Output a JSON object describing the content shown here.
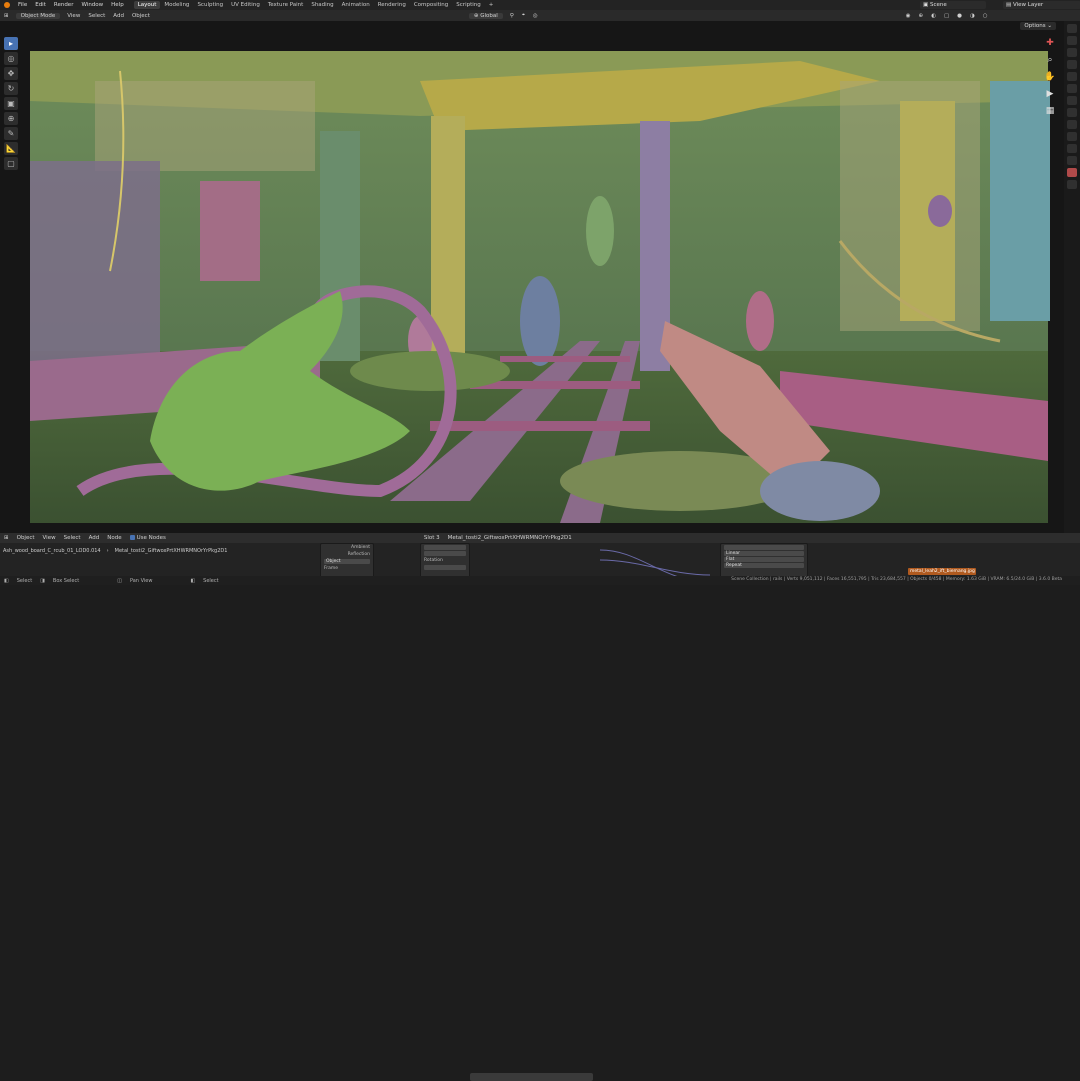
{
  "menu": {
    "items": [
      "File",
      "Edit",
      "Render",
      "Window",
      "Help"
    ]
  },
  "workspaces": [
    "Layout",
    "Modeling",
    "Sculpting",
    "UV Editing",
    "Texture Paint",
    "Shading",
    "Animation",
    "Rendering",
    "Compositing",
    "Scripting"
  ],
  "scene": {
    "scene_label": "Scene",
    "view_layer_label": "View Layer"
  },
  "viewport_header": {
    "mode": "Object Mode",
    "menu": [
      "View",
      "Select",
      "Add",
      "Object"
    ],
    "orientation": "Global",
    "options": "Options"
  },
  "toolbar": {
    "tools": [
      "select",
      "cursor",
      "move",
      "rotate",
      "scale",
      "transform",
      "annotate",
      "measure",
      "add-cube"
    ]
  },
  "node_editor": {
    "header_items": [
      "Object",
      "View",
      "Select",
      "Add",
      "Node"
    ],
    "use_nodes": "Use Nodes",
    "slot": "Slot 3",
    "material": "Metal_tosti2_GiftwoxPrtXHWRMNOrYrPkg2D1",
    "breadcrumb": [
      "Ash_wood_board_C_rcub_01_LOD0.014",
      "Metal_tosti2_GiftwoxPrtXHWRMNOrYrPkg2D1"
    ],
    "node_labels": [
      "Ambient",
      "Reflection",
      "Object",
      "Frame",
      "Rotation",
      "Linear",
      "Flat",
      "Repeat"
    ],
    "image_name": "metal_leah2_ift_biemang.jpg"
  },
  "status": {
    "select": "Select",
    "box_select": "Box Select",
    "pan_view": "Pan View",
    "select2": "Select"
  },
  "stats": "Scene Collection | rails | Verts 9,051,112 | Faces 16,551,795 | Tris 23,684,557 | Objects 0/458 | Memory: 1.63 GiB | VRAM: 6.5/24.0 GiB | 3.6.0 Beta",
  "colors": {
    "accent": "#4772b3",
    "warning": "#b05a1f"
  }
}
